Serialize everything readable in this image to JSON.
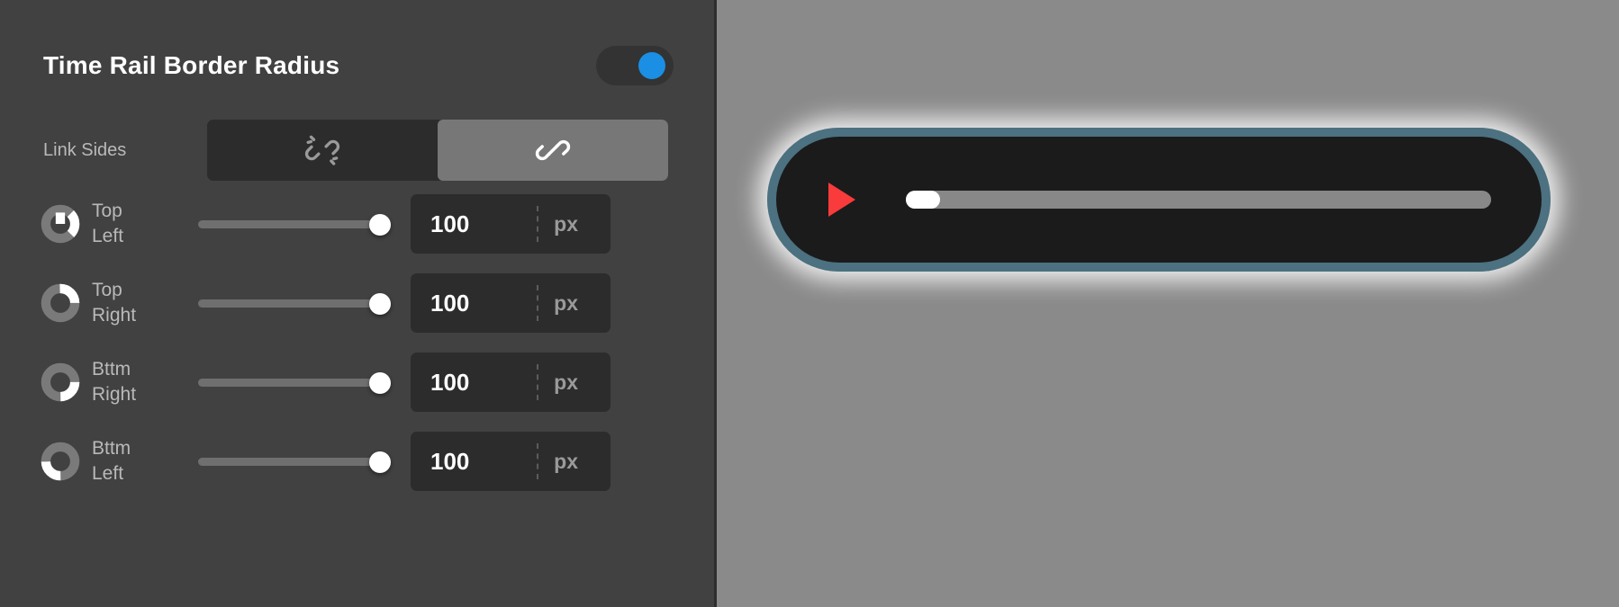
{
  "panel": {
    "title": "Time Rail Border Radius",
    "enabled_toggle": {
      "name": "enable-toggle",
      "state": "on",
      "accent_color": "#1a8fe3"
    },
    "link_sides": {
      "label": "Link Sides",
      "options": [
        {
          "icon": "unlink-icon",
          "active": false
        },
        {
          "icon": "link-icon",
          "active": true
        }
      ]
    },
    "rows": [
      {
        "icon": "corner-top-left-icon",
        "label": "Top\nLeft",
        "value": "100",
        "unit": "px",
        "slider_percent": 100
      },
      {
        "icon": "corner-top-right-icon",
        "label": "Top\nRight",
        "value": "100",
        "unit": "px",
        "slider_percent": 100
      },
      {
        "icon": "corner-bottom-right-icon",
        "label": "Bttm\nRight",
        "value": "100",
        "unit": "px",
        "slider_percent": 100
      },
      {
        "icon": "corner-bottom-left-icon",
        "label": "Bttm\nLeft",
        "value": "100",
        "unit": "px",
        "slider_percent": 100
      }
    ]
  },
  "preview": {
    "player": {
      "play_icon": "play-triangle-icon",
      "play_color": "#f93b3b",
      "border_color": "#4c7180",
      "background_color": "#1b1b1b",
      "time_rail": {
        "track_color": "#888888",
        "fill_color": "#ffffff",
        "progress_percent": 4
      }
    },
    "background_color": "#8a8a8a"
  }
}
